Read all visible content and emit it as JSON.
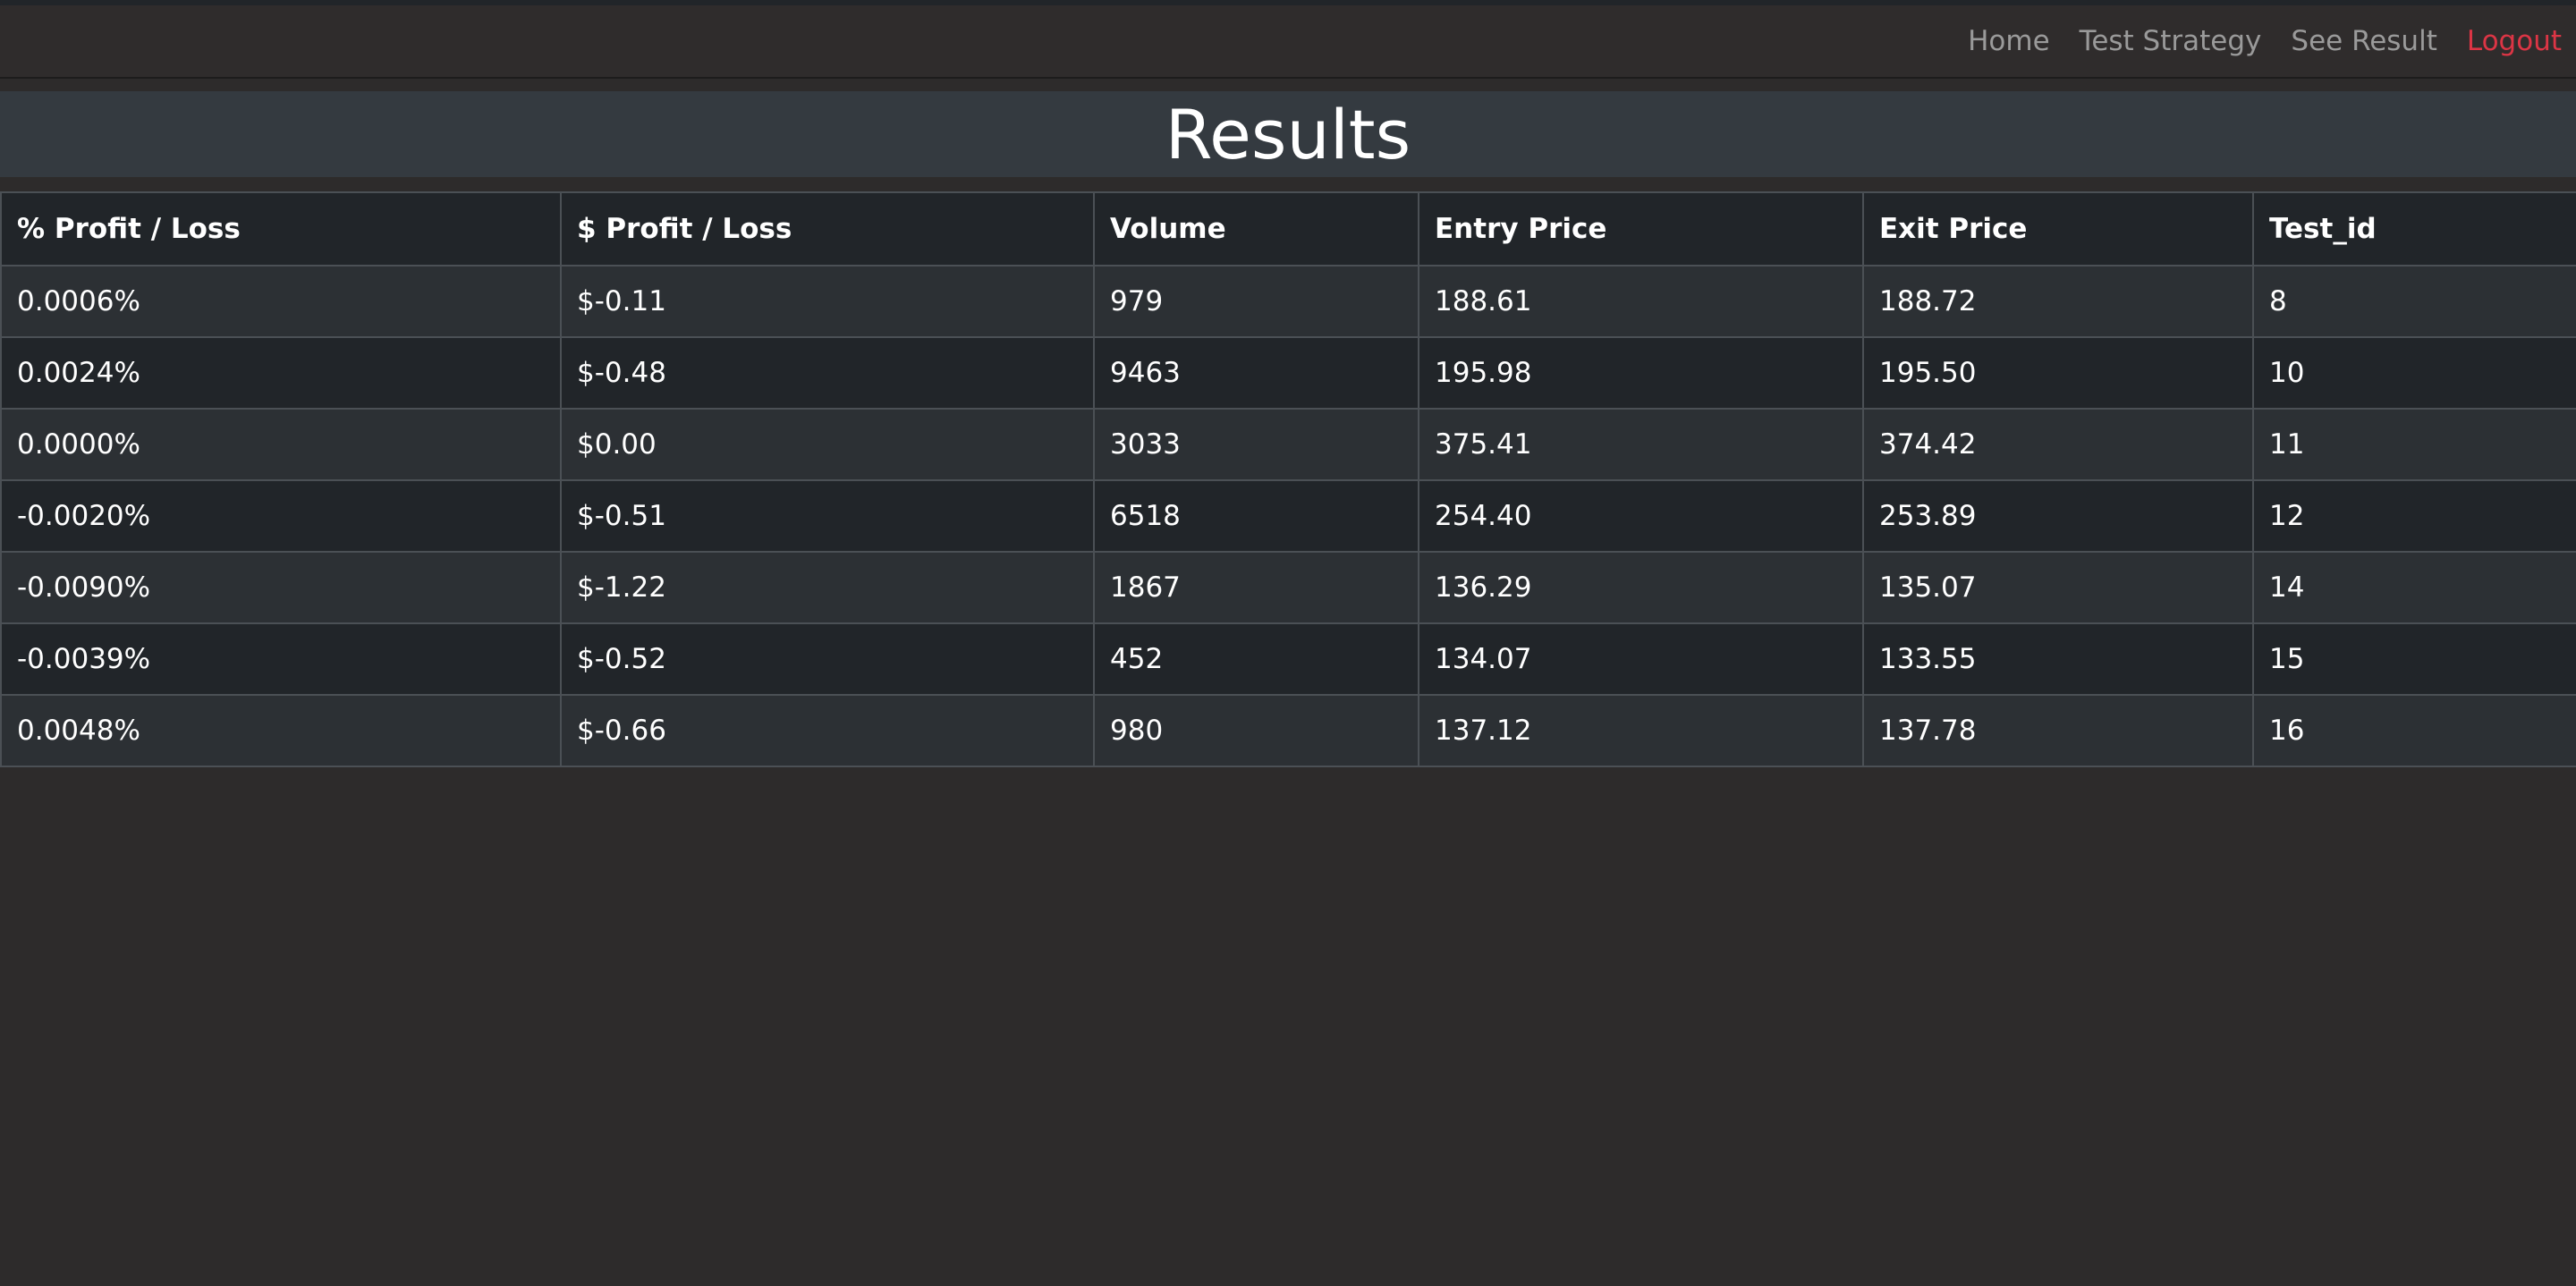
{
  "nav": {
    "home": "Home",
    "test_strategy": "Test Strategy",
    "see_result": "See Result",
    "logout": "Logout"
  },
  "colors": {
    "logout": "#dc3545",
    "banner": "#343a40",
    "page_background": "#2d2b2b"
  },
  "page": {
    "title": "Results"
  },
  "table": {
    "headers": [
      "% Profit / Loss",
      "$ Profit / Loss",
      "Volume",
      "Entry Price",
      "Exit Price",
      "Test_id"
    ],
    "rows": [
      [
        "0.0006%",
        "$-0.11",
        "979",
        "188.61",
        "188.72",
        "8"
      ],
      [
        "0.0024%",
        "$-0.48",
        "9463",
        "195.98",
        "195.50",
        "10"
      ],
      [
        "0.0000%",
        "$0.00",
        "3033",
        "375.41",
        "374.42",
        "11"
      ],
      [
        "-0.0020%",
        "$-0.51",
        "6518",
        "254.40",
        "253.89",
        "12"
      ],
      [
        "-0.0090%",
        "$-1.22",
        "1867",
        "136.29",
        "135.07",
        "14"
      ],
      [
        "-0.0039%",
        "$-0.52",
        "452",
        "134.07",
        "133.55",
        "15"
      ],
      [
        "0.0048%",
        "$-0.66",
        "980",
        "137.12",
        "137.78",
        "16"
      ]
    ]
  }
}
